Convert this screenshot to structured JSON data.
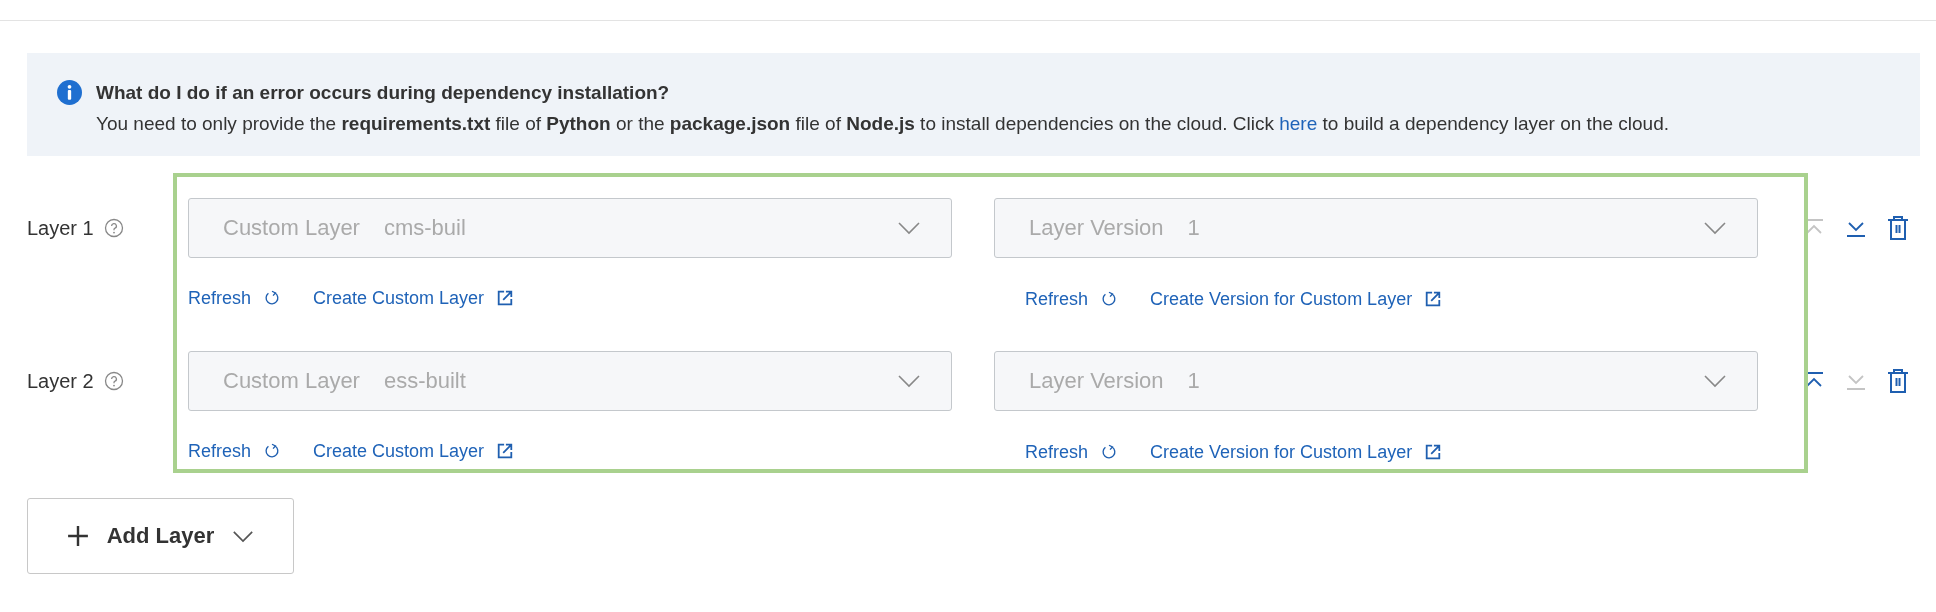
{
  "notice": {
    "title": "What do I do if an error occurs during dependency installation?",
    "text_before": "You need to only provide the **requirements.txt** file of **Python** or the **package.json** file of **Node.js** to install dependencies on the cloud. Click ",
    "link": "here",
    "text_after": " to build a dependency layer on the cloud."
  },
  "layers": [
    {
      "label": "Layer 1",
      "layer_select": {
        "label": "Custom Layer",
        "value": "cms-buil"
      },
      "version_select": {
        "label": "Layer Version",
        "value": "1"
      },
      "layer_refresh": "Refresh",
      "layer_create": "Create Custom Layer",
      "version_refresh": "Refresh",
      "version_create": "Create Version for Custom Layer",
      "move_up_disabled": true,
      "move_down_disabled": false
    },
    {
      "label": "Layer 2",
      "layer_select": {
        "label": "Custom Layer",
        "value": "ess-built"
      },
      "version_select": {
        "label": "Layer Version",
        "value": "1"
      },
      "layer_refresh": "Refresh",
      "layer_create": "Create Custom Layer",
      "version_refresh": "Refresh",
      "version_create": "Create Version for Custom Layer",
      "move_up_disabled": false,
      "move_down_disabled": true
    }
  ],
  "add_button": "Add Layer"
}
